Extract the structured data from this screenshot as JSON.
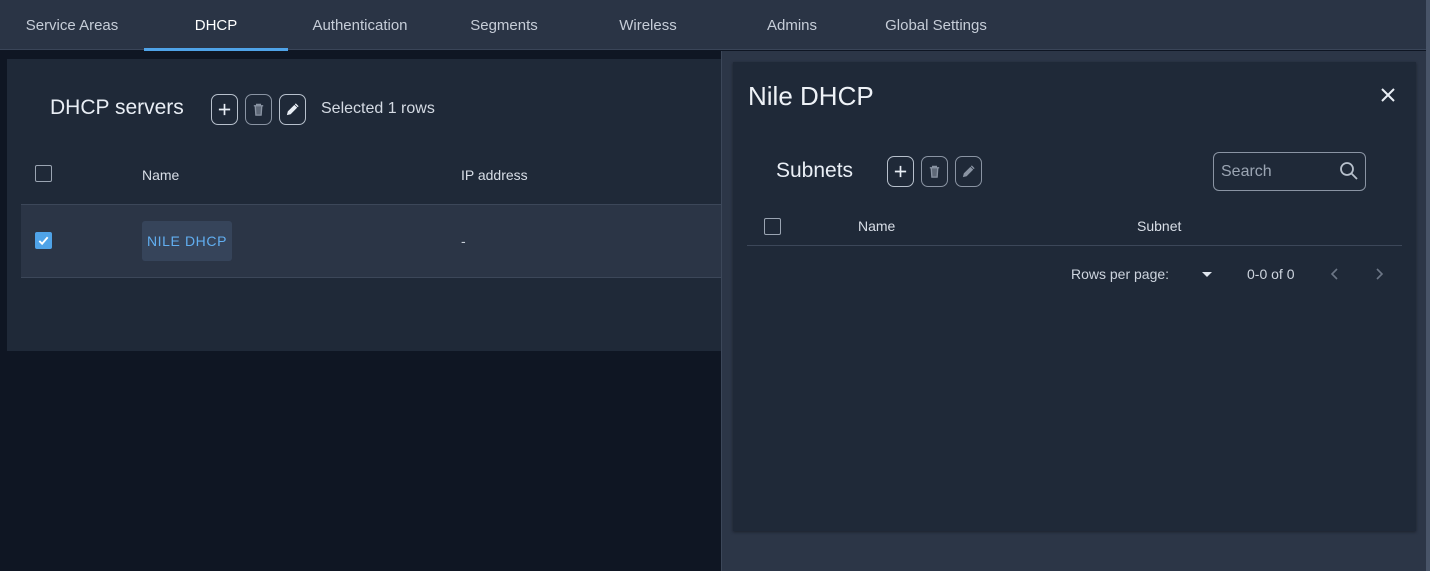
{
  "tabs": [
    {
      "label": "Service Areas",
      "active": false
    },
    {
      "label": "DHCP",
      "active": true
    },
    {
      "label": "Authentication",
      "active": false
    },
    {
      "label": "Segments",
      "active": false
    },
    {
      "label": "Wireless",
      "active": false
    },
    {
      "label": "Admins",
      "active": false
    },
    {
      "label": "Global Settings",
      "active": false
    }
  ],
  "servers": {
    "title": "DHCP servers",
    "selected_text": "Selected 1 rows",
    "columns": {
      "name": "Name",
      "ip": "IP address"
    },
    "rows": [
      {
        "name": "NILE DHCP",
        "ip": "-",
        "checked": true
      }
    ]
  },
  "panel": {
    "title": "Nile DHCP",
    "subnets": {
      "title": "Subnets",
      "search_placeholder": "Search",
      "search_value": "",
      "columns": {
        "name": "Name",
        "subnet": "Subnet"
      },
      "rows_per_page_label": "Rows per page:",
      "range": "0-0 of 0"
    }
  },
  "colors": {
    "accent": "#4fa3e8",
    "background": "#0f1623",
    "card": "#1f2938",
    "tabbar": "#2a3445"
  },
  "icons": [
    "plus-icon",
    "trash-icon",
    "pencil-icon",
    "close-icon",
    "search-icon",
    "dropdown-caret-icon",
    "chevron-left-icon",
    "chevron-right-icon",
    "check-icon"
  ]
}
